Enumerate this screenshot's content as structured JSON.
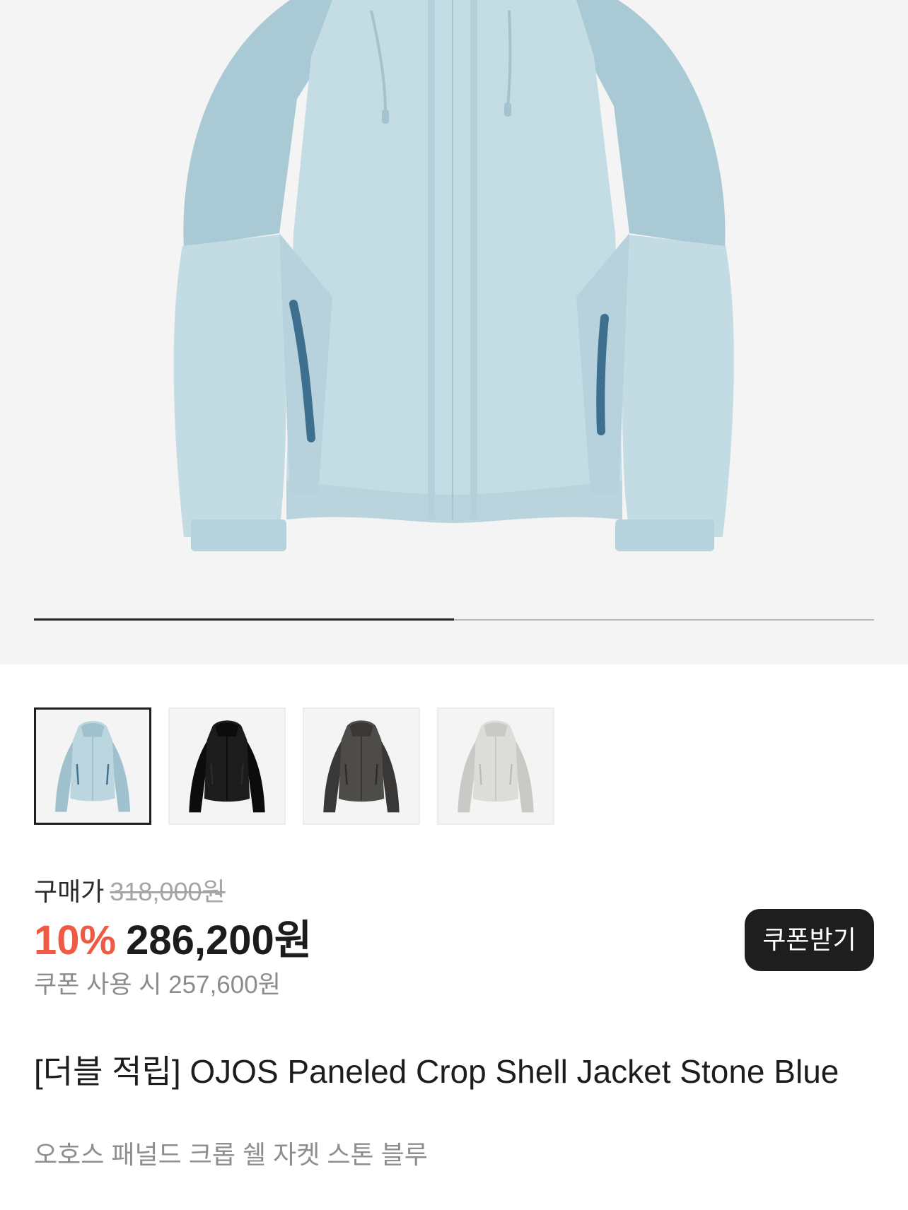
{
  "gallery": {
    "main_image": "OJOS Paneled Crop Shell Jacket - Stone Blue",
    "slide_progress": 0.5,
    "thumbnails": [
      {
        "color_name": "stone-blue",
        "body": "#bcd6df",
        "shade": "#9fc1cd",
        "zip": "#3f6f8f",
        "selected": true
      },
      {
        "color_name": "black",
        "body": "#1c1c1c",
        "shade": "#0c0c0c",
        "zip": "#2a2a2a",
        "selected": false
      },
      {
        "color_name": "charcoal",
        "body": "#4e4c49",
        "shade": "#3a3836",
        "zip": "#2e2d2b",
        "selected": false
      },
      {
        "color_name": "light-grey",
        "body": "#dcdcd8",
        "shade": "#c9c9c5",
        "zip": "#bdbdb8",
        "selected": false
      }
    ]
  },
  "price": {
    "label": "구매가",
    "original": "318,000원",
    "discount_rate": "10%",
    "sale_price": "286,200원",
    "coupon_price": "쿠폰 사용 시 257,600원",
    "coupon_button": "쿠폰받기"
  },
  "product": {
    "title": "[더블 적립] OJOS Paneled Crop Shell Jacket Stone Blue",
    "subtitle": "오호스 패널드 크롭 쉘 자켓 스톤 블루"
  },
  "colors": {
    "discount": "#ef5a45",
    "hero_background": "#f4f4f4",
    "button_background": "#1e1e1e"
  }
}
